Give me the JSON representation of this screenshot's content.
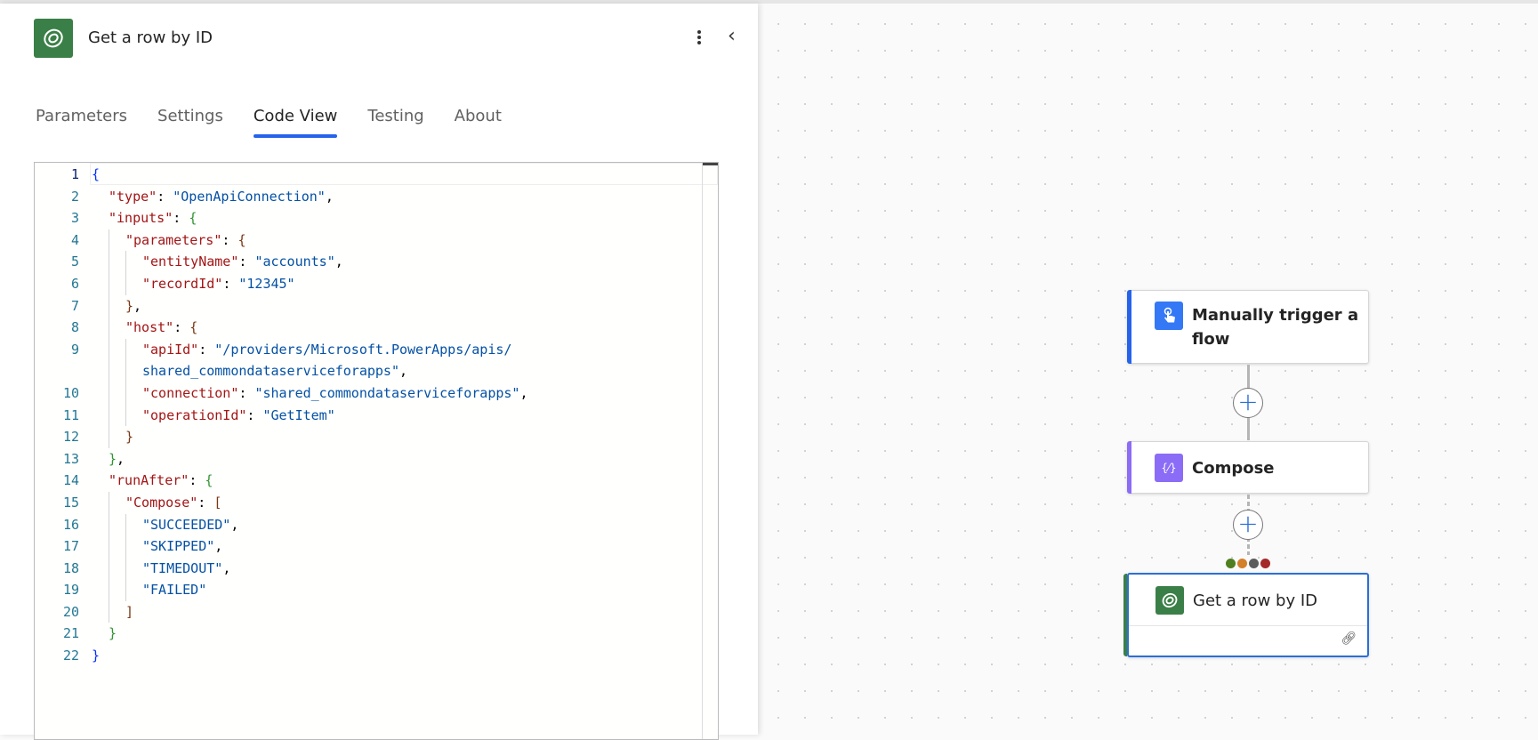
{
  "panel": {
    "title": "Get a row by ID",
    "icon": "dataverse-icon",
    "tabs": [
      {
        "label": "Parameters",
        "active": false
      },
      {
        "label": "Settings",
        "active": false
      },
      {
        "label": "Code View",
        "active": true
      },
      {
        "label": "Testing",
        "active": false
      },
      {
        "label": "About",
        "active": false
      }
    ]
  },
  "code": [
    {
      "n": "1",
      "indent": 0,
      "tokens": [
        [
          "b1",
          "{"
        ]
      ]
    },
    {
      "n": "2",
      "indent": 1,
      "tokens": [
        [
          "k",
          "\"type\""
        ],
        [
          "p",
          ": "
        ],
        [
          "s",
          "\"OpenApiConnection\""
        ],
        [
          "p",
          ","
        ]
      ]
    },
    {
      "n": "3",
      "indent": 1,
      "tokens": [
        [
          "k",
          "\"inputs\""
        ],
        [
          "p",
          ": "
        ],
        [
          "b2",
          "{"
        ]
      ]
    },
    {
      "n": "4",
      "indent": 2,
      "tokens": [
        [
          "k",
          "\"parameters\""
        ],
        [
          "p",
          ": "
        ],
        [
          "b3",
          "{"
        ]
      ]
    },
    {
      "n": "5",
      "indent": 3,
      "tokens": [
        [
          "k",
          "\"entityName\""
        ],
        [
          "p",
          ": "
        ],
        [
          "s",
          "\"accounts\""
        ],
        [
          "p",
          ","
        ]
      ]
    },
    {
      "n": "6",
      "indent": 3,
      "tokens": [
        [
          "k",
          "\"recordId\""
        ],
        [
          "p",
          ": "
        ],
        [
          "s",
          "\"12345\""
        ]
      ]
    },
    {
      "n": "7",
      "indent": 2,
      "tokens": [
        [
          "b3",
          "}"
        ],
        [
          "p",
          ","
        ]
      ]
    },
    {
      "n": "8",
      "indent": 2,
      "tokens": [
        [
          "k",
          "\"host\""
        ],
        [
          "p",
          ": "
        ],
        [
          "b3",
          "{"
        ]
      ]
    },
    {
      "n": "9",
      "indent": 3,
      "tokens": [
        [
          "k",
          "\"apiId\""
        ],
        [
          "p",
          ": "
        ],
        [
          "s",
          "\"/providers/Microsoft.PowerApps/apis/"
        ]
      ]
    },
    {
      "n": "",
      "indent": 3,
      "tokens": [
        [
          "s",
          "shared_commondataserviceforapps\""
        ],
        [
          "p",
          ","
        ]
      ]
    },
    {
      "n": "10",
      "indent": 3,
      "tokens": [
        [
          "k",
          "\"connection\""
        ],
        [
          "p",
          ": "
        ],
        [
          "s",
          "\"shared_commondataserviceforapps\""
        ],
        [
          "p",
          ","
        ]
      ]
    },
    {
      "n": "11",
      "indent": 3,
      "tokens": [
        [
          "k",
          "\"operationId\""
        ],
        [
          "p",
          ": "
        ],
        [
          "s",
          "\"GetItem\""
        ]
      ]
    },
    {
      "n": "12",
      "indent": 2,
      "tokens": [
        [
          "b3",
          "}"
        ]
      ]
    },
    {
      "n": "13",
      "indent": 1,
      "tokens": [
        [
          "b2",
          "}"
        ],
        [
          "p",
          ","
        ]
      ]
    },
    {
      "n": "14",
      "indent": 1,
      "tokens": [
        [
          "k",
          "\"runAfter\""
        ],
        [
          "p",
          ": "
        ],
        [
          "b2",
          "{"
        ]
      ]
    },
    {
      "n": "15",
      "indent": 2,
      "tokens": [
        [
          "k",
          "\"Compose\""
        ],
        [
          "p",
          ": "
        ],
        [
          "b3",
          "["
        ]
      ]
    },
    {
      "n": "16",
      "indent": 3,
      "tokens": [
        [
          "s",
          "\"SUCCEEDED\""
        ],
        [
          "p",
          ","
        ]
      ]
    },
    {
      "n": "17",
      "indent": 3,
      "tokens": [
        [
          "s",
          "\"SKIPPED\""
        ],
        [
          "p",
          ","
        ]
      ]
    },
    {
      "n": "18",
      "indent": 3,
      "tokens": [
        [
          "s",
          "\"TIMEDOUT\""
        ],
        [
          "p",
          ","
        ]
      ]
    },
    {
      "n": "19",
      "indent": 3,
      "tokens": [
        [
          "s",
          "\"FAILED\""
        ]
      ]
    },
    {
      "n": "20",
      "indent": 2,
      "tokens": [
        [
          "b3",
          "]"
        ]
      ]
    },
    {
      "n": "21",
      "indent": 1,
      "tokens": [
        [
          "b2",
          "}"
        ]
      ]
    },
    {
      "n": "22",
      "indent": 0,
      "tokens": [
        [
          "b1",
          "}"
        ]
      ]
    }
  ],
  "flow": {
    "trigger": {
      "label_line1": "Manually trigger a",
      "label_line2": "flow",
      "color": "#2563eb"
    },
    "compose": {
      "label": "Compose",
      "color": "#8b6cf6"
    },
    "action": {
      "label": "Get a row by ID",
      "color": "#3a7f47"
    },
    "run_after_colors": [
      "#4f7f1f",
      "#d47f2a",
      "#5c5c5c",
      "#a52a2a"
    ]
  }
}
